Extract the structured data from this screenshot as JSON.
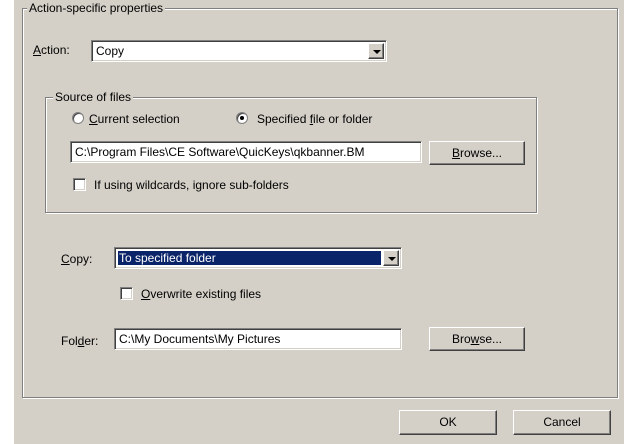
{
  "props_group": {
    "title": "Action-specific properties"
  },
  "action": {
    "label_prefix": "",
    "label_key": "A",
    "label_rest": "ction:",
    "value": "Copy"
  },
  "source": {
    "title": "Source of files",
    "radio_current": {
      "key": "C",
      "rest": "urrent selection"
    },
    "radio_specified": {
      "pre": "Specified ",
      "key": "f",
      "rest": "ile or folder"
    },
    "path_value": "C:\\Program Files\\CE Software\\QuicKeys\\qkbanner.BM",
    "browse": {
      "key": "B",
      "rest": "rowse..."
    },
    "wildcard_label": "If using wildcards, ignore sub-folders"
  },
  "copy": {
    "label_key": "C",
    "label_rest": "opy:",
    "value": "To specified folder"
  },
  "overwrite": {
    "key": "O",
    "rest": "verwrite existing files"
  },
  "folder": {
    "label_pre": "Fol",
    "label_key": "d",
    "label_rest": "er:",
    "value": "C:\\My Documents\\My Pictures",
    "browse": {
      "pre": "Bro",
      "key": "w",
      "rest": "se..."
    }
  },
  "buttons": {
    "ok": "OK",
    "cancel": "Cancel"
  },
  "colors": {
    "face": "#d4d0c8",
    "selection": "#0a246a"
  }
}
